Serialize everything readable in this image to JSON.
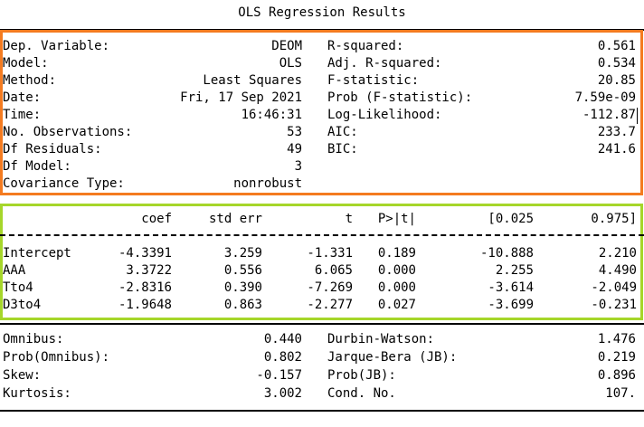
{
  "title": "OLS Regression Results",
  "summary": {
    "left": [
      {
        "label": "Dep. Variable:",
        "value": "DEOM"
      },
      {
        "label": "Model:",
        "value": "OLS"
      },
      {
        "label": "Method:",
        "value": "Least Squares"
      },
      {
        "label": "Date:",
        "value": "Fri, 17 Sep 2021"
      },
      {
        "label": "Time:",
        "value": "16:46:31"
      },
      {
        "label": "No. Observations:",
        "value": "53"
      },
      {
        "label": "Df Residuals:",
        "value": "49"
      },
      {
        "label": "Df Model:",
        "value": "3"
      },
      {
        "label": "Covariance Type:",
        "value": "nonrobust"
      }
    ],
    "right": [
      {
        "label": "R-squared:",
        "value": "0.561"
      },
      {
        "label": "Adj. R-squared:",
        "value": "0.534"
      },
      {
        "label": "F-statistic:",
        "value": "20.85"
      },
      {
        "label": "Prob (F-statistic):",
        "value": "7.59e-09"
      },
      {
        "label": "Log-Likelihood:",
        "value": "-112.87"
      },
      {
        "label": "AIC:",
        "value": "233.7"
      },
      {
        "label": "BIC:",
        "value": "241.6"
      }
    ]
  },
  "coef_table": {
    "headers": [
      "coef",
      "std err",
      "t",
      "P>|t|",
      "[0.025",
      "0.975]"
    ],
    "rows": [
      {
        "name": "Intercept",
        "values": [
          "-4.3391",
          "3.259",
          "-1.331",
          "0.189",
          "-10.888",
          "2.210"
        ]
      },
      {
        "name": "AAA",
        "values": [
          "3.3722",
          "0.556",
          "6.065",
          "0.000",
          "2.255",
          "4.490"
        ]
      },
      {
        "name": "Tto4",
        "values": [
          "-2.8316",
          "0.390",
          "-7.269",
          "0.000",
          "-3.614",
          "-2.049"
        ]
      },
      {
        "name": "D3to4",
        "values": [
          "-1.9648",
          "0.863",
          "-2.277",
          "0.027",
          "-3.699",
          "-0.231"
        ]
      }
    ]
  },
  "diagnostics": {
    "left": [
      {
        "label": "Omnibus:",
        "value": "0.440"
      },
      {
        "label": "Prob(Omnibus):",
        "value": "0.802"
      },
      {
        "label": "Skew:",
        "value": "-0.157"
      },
      {
        "label": "Kurtosis:",
        "value": "3.002"
      }
    ],
    "right": [
      {
        "label": "Durbin-Watson:",
        "value": "1.476"
      },
      {
        "label": "Jarque-Bera (JB):",
        "value": "0.219"
      },
      {
        "label": "Prob(JB):",
        "value": "0.896"
      },
      {
        "label": "Cond. No.",
        "value": "107."
      }
    ]
  },
  "colors": {
    "summary_highlight": "#f47b20",
    "coef_highlight": "#a6d62a"
  }
}
